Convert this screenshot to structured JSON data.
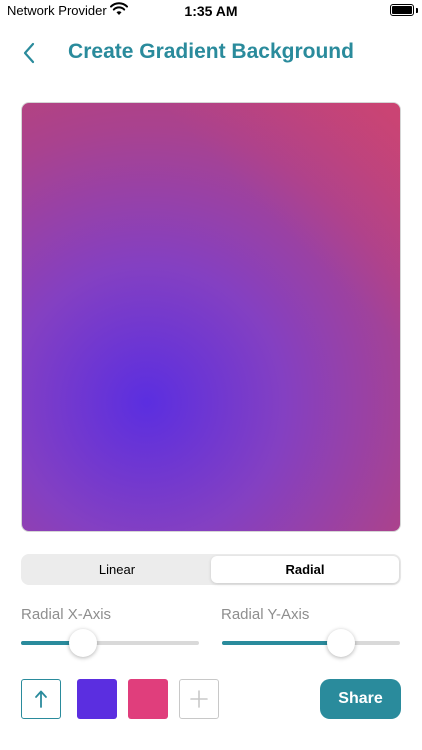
{
  "status_bar": {
    "carrier": "Network Provider",
    "time": "1:35 AM"
  },
  "nav": {
    "title": "Create Gradient Background",
    "back_icon": "chevron-left-icon"
  },
  "preview": {
    "mode": "radial",
    "colors": [
      "#5b2ee0",
      "#e03e7c"
    ]
  },
  "segmented": {
    "options": [
      "Linear",
      "Radial"
    ],
    "selected": "Radial"
  },
  "sliders": {
    "x_axis": {
      "label": "Radial X-Axis",
      "value": 0.35
    },
    "y_axis": {
      "label": "Radial Y-Axis",
      "value": 0.67
    }
  },
  "toolbar": {
    "direction_icon": "arrow-up-icon",
    "swatches": [
      "#5b2ee0",
      "#e03e7c"
    ],
    "add_icon": "plus-icon",
    "share_label": "Share"
  },
  "theme": {
    "accent": "#2a8b9c"
  }
}
